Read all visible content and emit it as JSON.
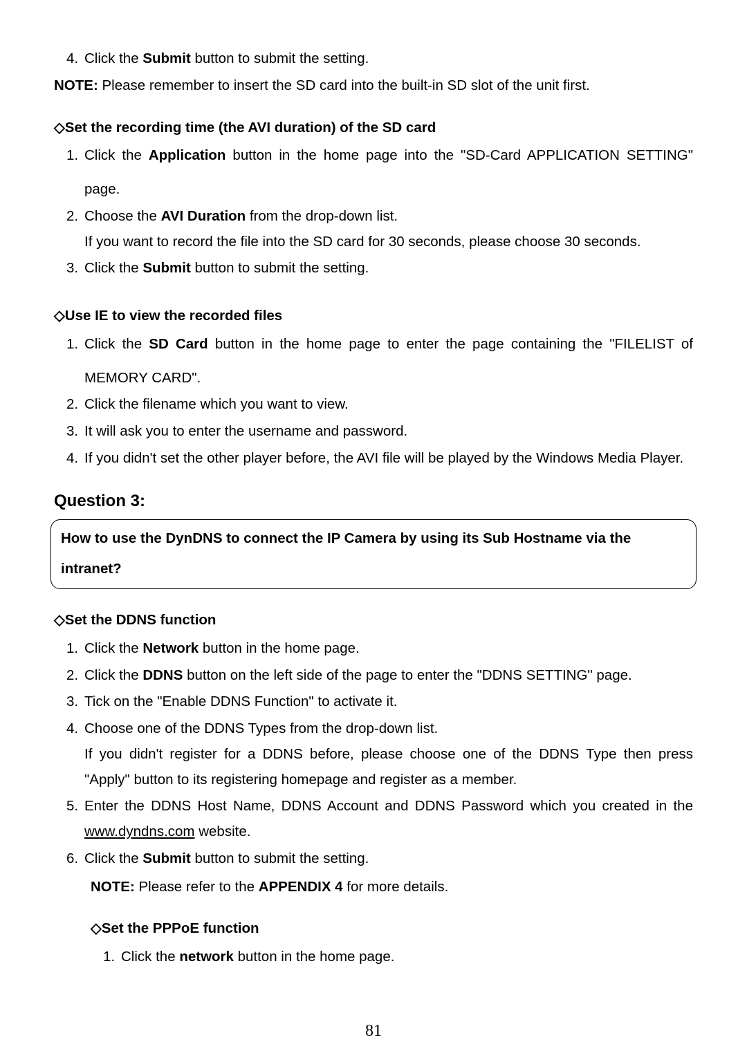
{
  "step4_prev": {
    "num": "4.",
    "pre": "Click the ",
    "bold": "Submit",
    "post": " button to submit the setting."
  },
  "note_prev": {
    "label": "NOTE:",
    "text": " Please remember to insert the SD card into the built-in SD slot of the unit first."
  },
  "sec_rec": {
    "heading": "◇Set the recording time (the AVI duration) of the SD card",
    "items": [
      {
        "num": "1.",
        "line1_pre": "Click the ",
        "line1_bold": "Application",
        "line1_post": " button in the home page into the \"SD-Card APPLICATION SETTING\"",
        "line2": "page."
      },
      {
        "num": "2.",
        "line1_pre": "Choose the ",
        "line1_bold": "AVI Duration",
        "line1_post": " from the drop-down list.",
        "line2": "If you want to record the file into the SD card for 30 seconds, please choose 30 seconds."
      },
      {
        "num": "3.",
        "line1_pre": "Click the ",
        "line1_bold": "Submit",
        "line1_post": " button to submit the setting."
      }
    ]
  },
  "sec_ie": {
    "heading": "◇Use IE to view the recorded files",
    "items": [
      {
        "num": "1.",
        "line1_pre": "Click the ",
        "line1_bold": "SD Card",
        "line1_post": " button in the home page to enter the page containing the \"FILELIST of",
        "line2": "MEMORY CARD\"."
      },
      {
        "num": "2.",
        "text": "Click the filename which you want to view."
      },
      {
        "num": "3.",
        "text": "It will ask you to enter the username and password."
      },
      {
        "num": "4.",
        "text": "If you didn't set the other player before, the AVI file will be played by the Windows Media Player."
      }
    ]
  },
  "q3": {
    "label": "Question 3:",
    "line1": "How to use the DynDNS to connect the IP Camera by using its Sub Hostname via the",
    "line2": "intranet?"
  },
  "sec_ddns": {
    "heading": "◇Set the DDNS function",
    "items": [
      {
        "num": "1.",
        "pre": "Click the ",
        "bold": "Network",
        "post": " button in the home page."
      },
      {
        "num": "2.",
        "pre": "Click the ",
        "bold": "DDNS",
        "post": " button on the left side of the page to enter the \"DDNS SETTING\" page."
      },
      {
        "num": "3.",
        "text": "Tick on the \"Enable DDNS Function\" to activate it."
      },
      {
        "num": "4.",
        "text": "Choose one of the DDNS Types from the drop-down list.",
        "extra1": "If you didn't register for a DDNS before, please choose one of the DDNS Type then press",
        "extra2": "\"Apply\" button to its registering homepage and register as a member."
      },
      {
        "num": "5.",
        "line1": "Enter the DDNS Host Name, DDNS Account and DDNS Password which you created in the",
        "link": "www.dyndns.com",
        "tail": " website."
      },
      {
        "num": "6.",
        "pre": "Click the ",
        "bold": "Submit",
        "post": " button to submit the setting."
      }
    ],
    "note": {
      "label": "NOTE:",
      "pre": " Please refer to the ",
      "bold": "APPENDIX 4",
      "post": " for more details."
    }
  },
  "sec_pppoe": {
    "heading": "◇Set the PPPoE function",
    "item": {
      "num": "1.",
      "pre": "Click the ",
      "bold": "network",
      "post": " button in the home page."
    }
  },
  "pagenum": "81"
}
